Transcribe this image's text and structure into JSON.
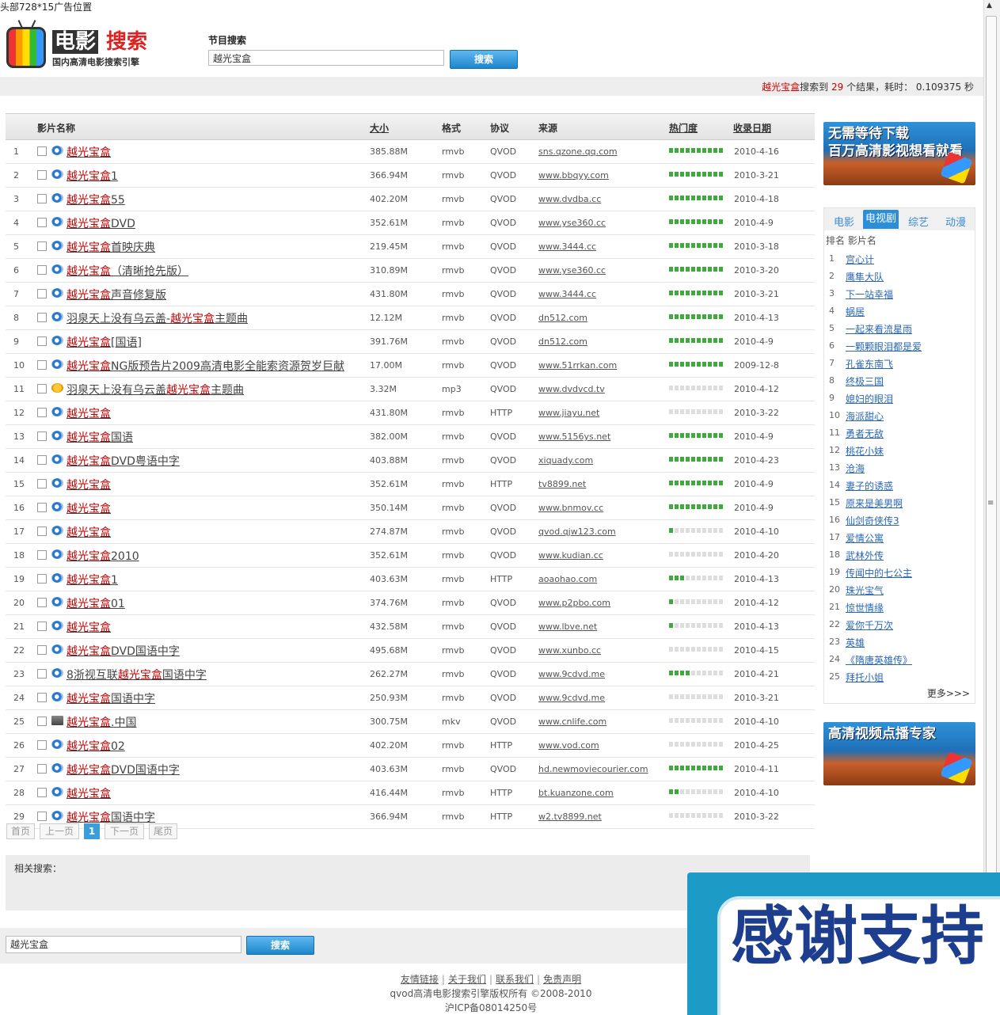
{
  "top_ad": "头部728*15广告位置",
  "logo": {
    "title_a": "电影",
    "title_b": "搜索",
    "subtitle": "国内高清电影搜索引擎"
  },
  "search": {
    "label": "节目搜索",
    "value": "越光宝盒",
    "button": "搜索"
  },
  "result_summary": {
    "keyword": "越光宝盒",
    "text1": "搜索到",
    "count": "29",
    "text2": "个结果，耗时：",
    "time": "0.109375 秒"
  },
  "table": {
    "headers": {
      "name": "影片名称",
      "size": "大小",
      "format": "格式",
      "protocol": "协议",
      "source": "来源",
      "hot": "热门度",
      "date": "收录日期"
    },
    "rows": [
      {
        "idx": "1",
        "pre": "",
        "kw": "越光宝盒",
        "post": "",
        "size": "385.88M",
        "fmt": "rmvb",
        "proto": "QVOD",
        "src": "sns.qzone.qq.com",
        "hot": 10,
        "date": "2010-4-16",
        "icon": "eye-icon"
      },
      {
        "idx": "2",
        "pre": "",
        "kw": "越光宝盒",
        "post": "1",
        "size": "366.94M",
        "fmt": "rmvb",
        "proto": "QVOD",
        "src": "www.bbqyy.com",
        "hot": 10,
        "date": "2010-3-21",
        "icon": "eye-icon"
      },
      {
        "idx": "3",
        "pre": "",
        "kw": "越光宝盒",
        "post": "55",
        "size": "402.20M",
        "fmt": "rmvb",
        "proto": "QVOD",
        "src": "www.dvdba.cc",
        "hot": 10,
        "date": "2010-4-18",
        "icon": "eye-icon"
      },
      {
        "idx": "4",
        "pre": "",
        "kw": "越光宝盒",
        "post": "DVD",
        "size": "352.61M",
        "fmt": "rmvb",
        "proto": "QVOD",
        "src": "www.yse360.cc",
        "hot": 10,
        "date": "2010-4-9",
        "icon": "eye-icon"
      },
      {
        "idx": "5",
        "pre": "",
        "kw": "越光宝盒",
        "post": "首映庆典",
        "size": "219.45M",
        "fmt": "rmvb",
        "proto": "QVOD",
        "src": "www.3444.cc",
        "hot": 10,
        "date": "2010-3-18",
        "icon": "eye-icon"
      },
      {
        "idx": "6",
        "pre": "",
        "kw": "越光宝盒",
        "post": "（清晰抢先版）",
        "size": "310.89M",
        "fmt": "rmvb",
        "proto": "QVOD",
        "src": "www.yse360.cc",
        "hot": 10,
        "date": "2010-3-20",
        "icon": "eye-icon"
      },
      {
        "idx": "7",
        "pre": "",
        "kw": "越光宝盒",
        "post": "声音修复版",
        "size": "431.80M",
        "fmt": "rmvb",
        "proto": "QVOD",
        "src": "www.3444.cc",
        "hot": 10,
        "date": "2010-3-21",
        "icon": "eye-icon"
      },
      {
        "idx": "8",
        "pre": "羽泉天上没有乌云盖-",
        "kw": "越光宝盒",
        "post": "主题曲",
        "size": "12.12M",
        "fmt": "rmvb",
        "proto": "QVOD",
        "src": "dn512.com",
        "hot": 10,
        "date": "2010-4-13",
        "icon": "eye-icon"
      },
      {
        "idx": "9",
        "pre": "",
        "kw": "越光宝盒",
        "post": "[国语]",
        "size": "391.76M",
        "fmt": "rmvb",
        "proto": "QVOD",
        "src": "dn512.com",
        "hot": 10,
        "date": "2010-4-9",
        "icon": "eye-icon"
      },
      {
        "idx": "10",
        "pre": "",
        "kw": "越光宝盒",
        "post": "NG版预告片2009高清电影全能索资源贺岁巨献",
        "size": "17.00M",
        "fmt": "rmvb",
        "proto": "QVOD",
        "src": "www.51rrkan.com",
        "hot": 10,
        "date": "2009-12-8",
        "icon": "eye-icon"
      },
      {
        "idx": "11",
        "pre": "羽泉天上没有乌云盖",
        "kw": "越光宝盒",
        "post": "主题曲",
        "size": "3.32M",
        "fmt": "mp3",
        "proto": "QVOD",
        "src": "www.dvdvcd.tv",
        "hot": 0,
        "date": "2010-4-12",
        "icon": "music-icon"
      },
      {
        "idx": "12",
        "pre": "",
        "kw": "越光宝盒",
        "post": "",
        "size": "431.80M",
        "fmt": "rmvb",
        "proto": "HTTP",
        "src": "www.jiayu.net",
        "hot": 0,
        "date": "2010-3-22",
        "icon": "eye-icon"
      },
      {
        "idx": "13",
        "pre": "",
        "kw": "越光宝盒",
        "post": "国语",
        "size": "382.00M",
        "fmt": "rmvb",
        "proto": "QVOD",
        "src": "www.5156ys.net",
        "hot": 10,
        "date": "2010-4-9",
        "icon": "eye-icon"
      },
      {
        "idx": "14",
        "pre": "",
        "kw": "越光宝盒",
        "post": "DVD粤语中字",
        "size": "403.88M",
        "fmt": "rmvb",
        "proto": "QVOD",
        "src": "xiquady.com",
        "hot": 10,
        "date": "2010-4-23",
        "icon": "eye-icon"
      },
      {
        "idx": "15",
        "pre": "",
        "kw": "越光宝盒",
        "post": "",
        "size": "352.61M",
        "fmt": "rmvb",
        "proto": "HTTP",
        "src": "tv8899.net",
        "hot": 10,
        "date": "2010-4-9",
        "icon": "eye-icon"
      },
      {
        "idx": "16",
        "pre": "",
        "kw": "越光宝盒",
        "post": "",
        "size": "350.14M",
        "fmt": "rmvb",
        "proto": "QVOD",
        "src": "www.bnmov.cc",
        "hot": 10,
        "date": "2010-4-9",
        "icon": "eye-icon"
      },
      {
        "idx": "17",
        "pre": "",
        "kw": "越光宝盒",
        "post": "",
        "size": "274.87M",
        "fmt": "rmvb",
        "proto": "QVOD",
        "src": "qvod.qjw123.com",
        "hot": 1,
        "date": "2010-4-10",
        "icon": "eye-icon"
      },
      {
        "idx": "18",
        "pre": "",
        "kw": "越光宝盒",
        "post": "2010",
        "size": "352.61M",
        "fmt": "rmvb",
        "proto": "QVOD",
        "src": "www.kudian.cc",
        "hot": 0,
        "date": "2010-4-20",
        "icon": "eye-icon"
      },
      {
        "idx": "19",
        "pre": "",
        "kw": "越光宝盒",
        "post": "1",
        "size": "403.63M",
        "fmt": "rmvb",
        "proto": "HTTP",
        "src": "aoaohao.com",
        "hot": 3,
        "date": "2010-4-13",
        "icon": "eye-icon"
      },
      {
        "idx": "20",
        "pre": "",
        "kw": "越光宝盒",
        "post": "01",
        "size": "374.76M",
        "fmt": "rmvb",
        "proto": "QVOD",
        "src": "www.p2pbo.com",
        "hot": 1,
        "date": "2010-4-12",
        "icon": "eye-icon"
      },
      {
        "idx": "21",
        "pre": "",
        "kw": "越光宝盒",
        "post": "",
        "size": "432.58M",
        "fmt": "rmvb",
        "proto": "QVOD",
        "src": "www.lbve.net",
        "hot": 1,
        "date": "2010-4-13",
        "icon": "eye-icon"
      },
      {
        "idx": "22",
        "pre": "",
        "kw": "越光宝盒",
        "post": "DVD国语中字",
        "size": "495.68M",
        "fmt": "rmvb",
        "proto": "QVOD",
        "src": "www.xunbo.cc",
        "hot": 0,
        "date": "2010-4-15",
        "icon": "eye-icon"
      },
      {
        "idx": "23",
        "pre": "8浙视互联",
        "kw": "越光宝盒",
        "post": "国语中字",
        "size": "262.27M",
        "fmt": "rmvb",
        "proto": "QVOD",
        "src": "www.9cdvd.me",
        "hot": 4,
        "date": "2010-4-21",
        "icon": "eye-icon"
      },
      {
        "idx": "24",
        "pre": "",
        "kw": "越光宝盒",
        "post": "国语中字",
        "size": "250.93M",
        "fmt": "rmvb",
        "proto": "QVOD",
        "src": "www.9cdvd.me",
        "hot": 0,
        "date": "2010-3-21",
        "icon": "eye-icon"
      },
      {
        "idx": "25",
        "pre": "",
        "kw": "越光宝盒",
        "post": ".中国",
        "size": "300.75M",
        "fmt": "mkv",
        "proto": "QVOD",
        "src": "www.cnlife.com",
        "hot": 0,
        "date": "2010-4-10",
        "icon": "film-icon"
      },
      {
        "idx": "26",
        "pre": "",
        "kw": "越光宝盒",
        "post": "02",
        "size": "402.20M",
        "fmt": "rmvb",
        "proto": "HTTP",
        "src": "www.vod.com",
        "hot": 0,
        "date": "2010-4-25",
        "icon": "eye-icon"
      },
      {
        "idx": "27",
        "pre": "",
        "kw": "越光宝盒",
        "post": "DVD国语中字",
        "size": "403.63M",
        "fmt": "rmvb",
        "proto": "QVOD",
        "src": "hd.newmoviecourier.com",
        "hot": 10,
        "date": "2010-4-11",
        "icon": "eye-icon"
      },
      {
        "idx": "28",
        "pre": "",
        "kw": "越光宝盒",
        "post": "",
        "size": "416.44M",
        "fmt": "rmvb",
        "proto": "HTTP",
        "src": "bt.kuanzone.com",
        "hot": 2,
        "date": "2010-4-10",
        "icon": "eye-icon"
      },
      {
        "idx": "29",
        "pre": "",
        "kw": "越光宝盒",
        "post": "国语中字",
        "size": "366.94M",
        "fmt": "rmvb",
        "proto": "HTTP",
        "src": "w2.tv8899.net",
        "hot": 0,
        "date": "2010-3-22",
        "icon": "eye-icon"
      }
    ]
  },
  "pager": {
    "first": "首页",
    "prev": "上一页",
    "current": "1",
    "next": "下一页",
    "last": "尾页"
  },
  "related": {
    "label": "相关搜索："
  },
  "bottom_search": {
    "value": "越光宝盒",
    "button": "搜索"
  },
  "footer": {
    "links": [
      "友情链接",
      "关于我们",
      "联系我们",
      "免责声明"
    ],
    "copyright": "qvod高清电影搜索引擎版权所有 ©2008-2010",
    "icp": "沪ICP备08014250号"
  },
  "sidebar": {
    "banner1": {
      "line1": "无需等待下载",
      "line2": "百万高清影视想看就看"
    },
    "banner2": {
      "line1": "高清视频点播专家"
    },
    "tabs": [
      "电影",
      "电视剧",
      "综艺",
      "动漫"
    ],
    "active_tab": "电视剧",
    "rank_header": "排名  影片名",
    "rank_items": [
      "宫心计",
      "鹰隼大队",
      "下一站幸福",
      "蜗居",
      "一起来看流星雨",
      "一颗颗眼泪都是爱",
      "孔雀东南飞",
      "终极三国",
      "媳妇的眼泪",
      "海派甜心",
      "勇者无敌",
      "桃花小妹",
      "沧海",
      "妻子的诱惑",
      "原来是美男啊",
      "仙剑奇侠传3",
      "爱情公寓",
      "武林外传",
      "传闻中的七公主",
      "珠光宝气",
      "惊世情缘",
      "爱你千万次",
      "英雄",
      "《隋唐英雄传》",
      "拜托小姐"
    ],
    "more": "更多>>>"
  },
  "overlay": {
    "text": "感谢支持"
  },
  "colors": {
    "keyword": "#cc0000",
    "accent": "#2c8ed6",
    "hot_on": "#3cab3c",
    "hot_off": "#dddddd"
  }
}
